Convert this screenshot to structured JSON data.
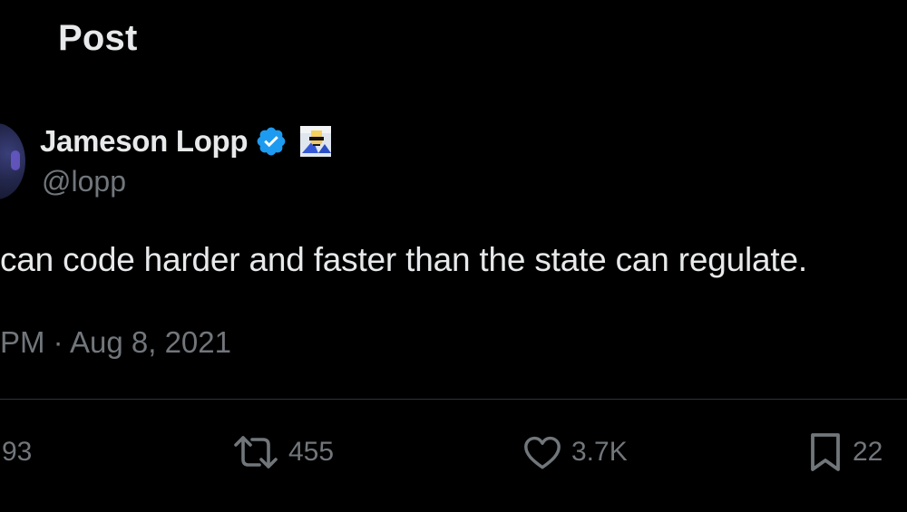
{
  "header": {
    "title": "Post"
  },
  "author": {
    "display_name": "Jameson Lopp",
    "handle": "@lopp",
    "verified_icon": "verified-badge-icon",
    "affiliate_icon": "affiliate-badge-icon",
    "colors": {
      "verified": "#1d9bf0"
    }
  },
  "tweet": {
    "text": "can code harder and faster than the state can regulate.",
    "timestamp": "PM · Aug 8, 2021"
  },
  "actions": {
    "replies": {
      "count": "93",
      "icon": "reply-icon"
    },
    "reposts": {
      "count": "455",
      "icon": "repost-icon"
    },
    "likes": {
      "count": "3.7K",
      "icon": "heart-icon"
    },
    "bookmarks": {
      "count": "22",
      "icon": "bookmark-icon"
    }
  },
  "theme": {
    "background": "#000000",
    "text_primary": "#e7e9ea",
    "text_secondary": "#71767b",
    "divider": "#2f3336"
  }
}
